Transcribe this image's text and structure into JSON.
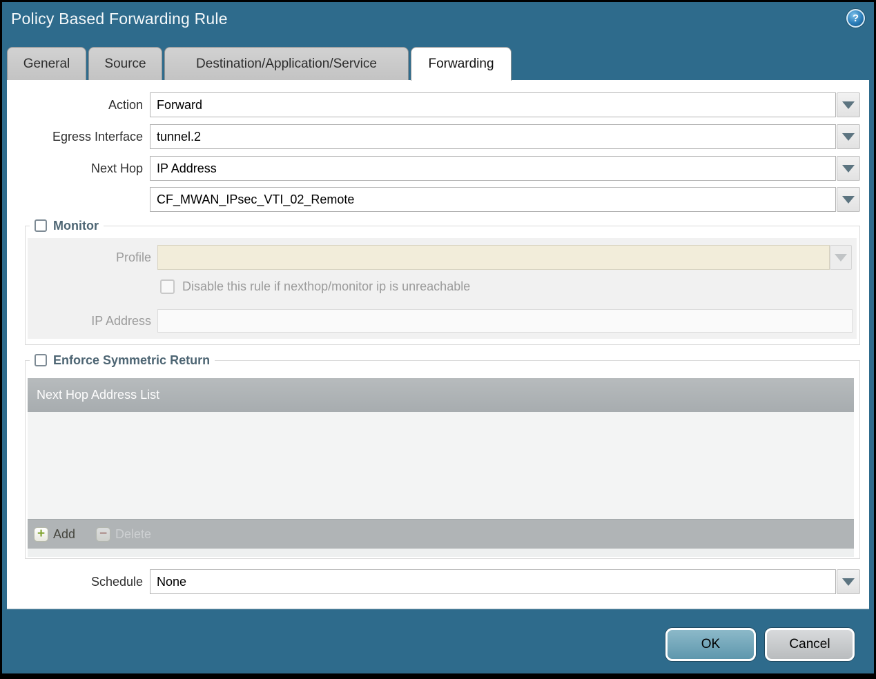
{
  "window": {
    "title": "Policy Based Forwarding Rule"
  },
  "icons": {
    "help": "?",
    "add": "+",
    "delete": "−"
  },
  "tabs": [
    {
      "label": "General",
      "active": false
    },
    {
      "label": "Source",
      "active": false
    },
    {
      "label": "Destination/Application/Service",
      "active": false
    },
    {
      "label": "Forwarding",
      "active": true
    }
  ],
  "form": {
    "action": {
      "label": "Action",
      "value": "Forward"
    },
    "egress_interface": {
      "label": "Egress Interface",
      "value": "tunnel.2"
    },
    "next_hop": {
      "label": "Next Hop",
      "value": "IP Address"
    },
    "next_hop_address": {
      "value": "CF_MWAN_IPsec_VTI_02_Remote"
    },
    "schedule": {
      "label": "Schedule",
      "value": "None"
    }
  },
  "monitor": {
    "legend": "Monitor",
    "checked": false,
    "profile": {
      "label": "Profile",
      "value": ""
    },
    "disable_rule": {
      "label": "Disable this rule if nexthop/monitor ip is unreachable",
      "checked": false
    },
    "ip_address": {
      "label": "IP Address",
      "value": ""
    }
  },
  "enforce_symmetric_return": {
    "legend": "Enforce Symmetric Return",
    "checked": false,
    "table": {
      "header": "Next Hop Address List",
      "rows": []
    },
    "buttons": {
      "add": "Add",
      "delete": "Delete"
    }
  },
  "dialog_buttons": {
    "ok": "OK",
    "cancel": "Cancel"
  },
  "colors": {
    "titlebar": "#2e6b8c",
    "accent_teal": "#6fa5ba",
    "legend_text": "#4d6573",
    "table_header": "#aeb3b6",
    "cream_field": "#f2edda"
  }
}
